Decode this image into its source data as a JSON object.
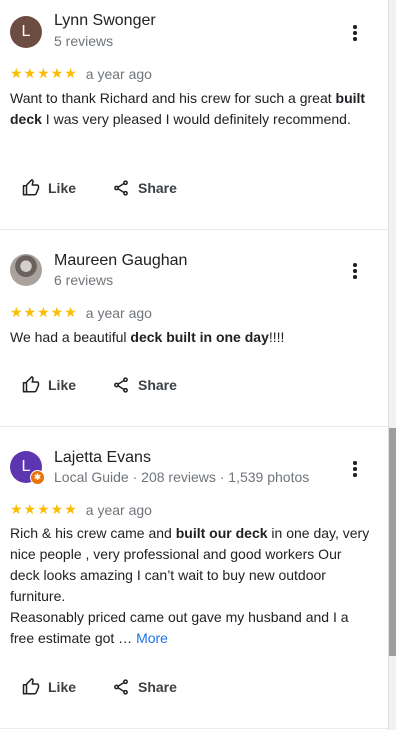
{
  "reviews": [
    {
      "avatar_letter": "L",
      "avatar_color": "#6d4c41",
      "name": "Lynn Swonger",
      "meta": "5 reviews",
      "stars": "★★★★★",
      "rating": 5,
      "time": "a year ago",
      "text": {
        "p1": "Want to thank Richard and his crew for such a great ",
        "b1": "built deck",
        "p2": " I was very pleased I would definitely recommend."
      },
      "like_label": "Like",
      "share_label": "Share"
    },
    {
      "avatar_letter": "",
      "name": "Maureen Gaughan",
      "meta": "6 reviews",
      "stars": "★★★★★",
      "rating": 5,
      "time": "a year ago",
      "text": {
        "p1": "We had a beautiful ",
        "b1": "deck built in one day",
        "p2": "!!!!"
      },
      "like_label": "Like",
      "share_label": "Share"
    },
    {
      "avatar_letter": "L",
      "avatar_color": "#5e35b1",
      "badge_color": "#e8710a",
      "name": "Lajetta Evans",
      "meta": "Local Guide · 208 reviews · 1,539 photos",
      "stars": "★★★★★",
      "rating": 5,
      "time": "a year ago",
      "text": {
        "p1": "Rich & his crew came and ",
        "b1": "built our deck",
        "p2": " in one day, very nice people , very professional and good workers Our deck looks amazing I can’t wait to buy new outdoor furniture.",
        "p3": "Reasonably priced came out gave my husband and I a free estimate got …",
        "more": "More"
      },
      "like_label": "Like",
      "share_label": "Share"
    }
  ],
  "icons": {
    "more_options": "more-vert-icon",
    "like": "thumb-up-icon",
    "share": "share-icon",
    "local_guide": "local-guide-badge-icon"
  }
}
